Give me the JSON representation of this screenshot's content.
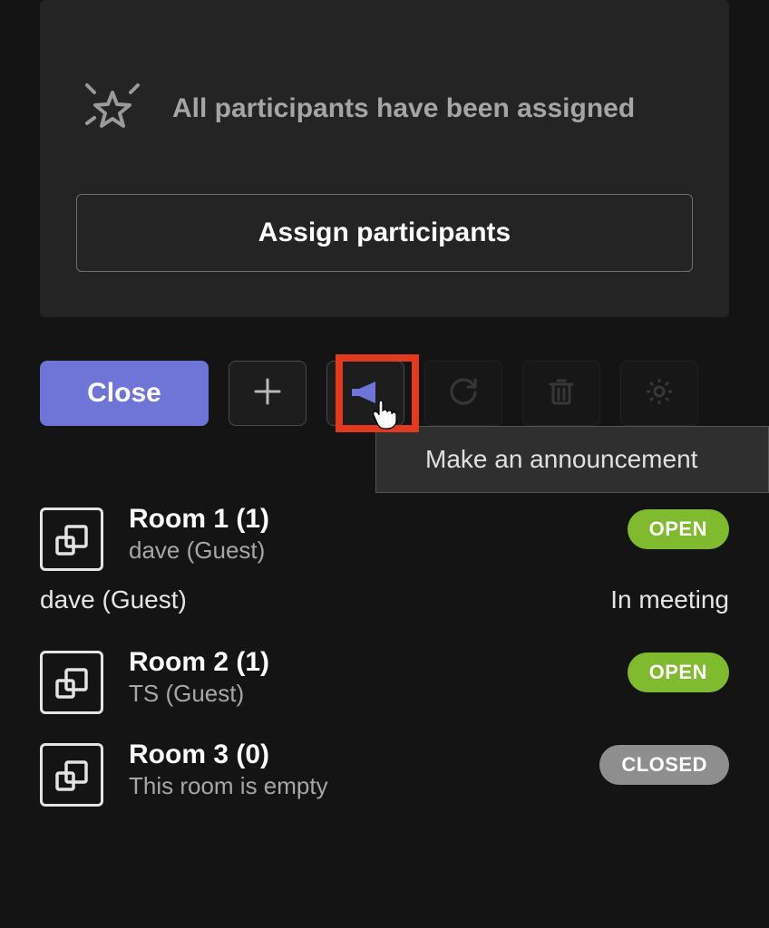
{
  "assign_panel": {
    "status_message": "All participants have been assigned",
    "assign_button": "Assign participants"
  },
  "toolbar": {
    "close_label": "Close"
  },
  "tooltip": {
    "text": "Make an announcement"
  },
  "rooms": [
    {
      "title": "Room 1  (1)",
      "subtitle": "dave (Guest)",
      "status": "OPEN",
      "status_kind": "open",
      "expanded_participant": "dave (Guest)",
      "expanded_status": "In meeting"
    },
    {
      "title": "Room 2  (1)",
      "subtitle": "TS (Guest)",
      "status": "OPEN",
      "status_kind": "open"
    },
    {
      "title": "Room 3  (0)",
      "subtitle": "This room is empty",
      "status": "CLOSED",
      "status_kind": "closed"
    }
  ]
}
